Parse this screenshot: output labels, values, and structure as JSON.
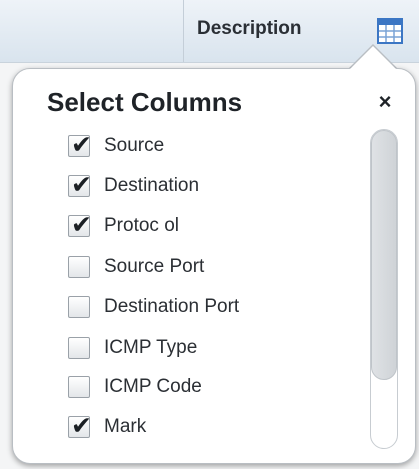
{
  "header": {
    "column_label": "Description",
    "grid_icon": "column-grid-icon"
  },
  "popup": {
    "title": "Select Columns",
    "close_label": "×",
    "items": [
      {
        "label": "Source",
        "checked": true
      },
      {
        "label": "Destination",
        "checked": true
      },
      {
        "label": "Protoc ol",
        "checked": true
      },
      {
        "label": "Source Port",
        "checked": false
      },
      {
        "label": "Destination Port",
        "checked": false
      },
      {
        "label": "ICMP Type",
        "checked": false
      },
      {
        "label": "ICMP Code",
        "checked": false
      },
      {
        "label": "Mark",
        "checked": true
      }
    ],
    "checkmark_glyph": "✔"
  },
  "colors": {
    "header_bg": "#d9e4ee",
    "popup_bg": "#ffffff",
    "grid_icon_blue": "#3b76c4"
  }
}
